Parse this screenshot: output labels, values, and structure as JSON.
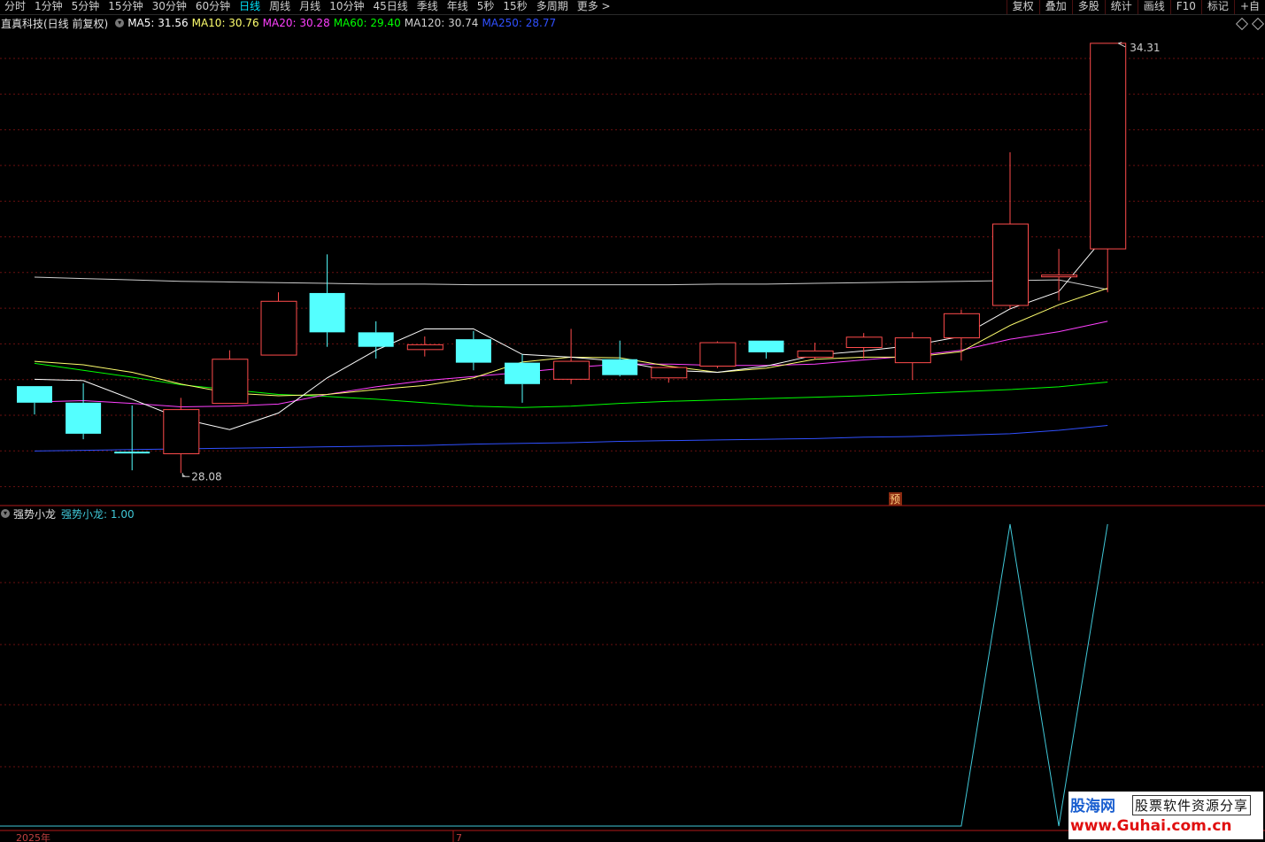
{
  "toolbar": {
    "periods": [
      "分时",
      "1分钟",
      "5分钟",
      "15分钟",
      "30分钟",
      "60分钟",
      "日线",
      "周线",
      "月线",
      "10分钟",
      "45日线",
      "季线",
      "年线",
      "5秒",
      "15秒",
      "多周期",
      "更多 >"
    ],
    "active_period": "日线",
    "right_buttons": [
      "复权",
      "叠加",
      "多股",
      "统计",
      "画线",
      "F10",
      "标记",
      "+自"
    ]
  },
  "main_info": {
    "title": "直真科技(日线 前复权)",
    "ma5": "MA5: 31.56",
    "ma10": "MA10: 30.76",
    "ma20": "MA20: 30.28",
    "ma60": "MA60: 29.40",
    "ma120": "MA120: 30.74",
    "ma250": "MA250: 28.77"
  },
  "colors": {
    "up": "#ff4c4c",
    "down": "#54ffff",
    "ma5": "#ffffff",
    "ma10": "#ffff6e",
    "ma20": "#ff40ff",
    "ma60": "#00ff00",
    "ma120": "#cccccc",
    "ma250": "#3050ff",
    "indicator": "#40c8d8",
    "grid": "#6a1010"
  },
  "price_labels": {
    "high": "34.31",
    "low": "28.08"
  },
  "pre_marker": "预",
  "sub_info": {
    "name": "强势小龙",
    "value_label": "强势小龙: 1.00"
  },
  "time_axis": {
    "labels": [
      "2025年",
      "7"
    ]
  },
  "watermark": {
    "site_name": "股海网",
    "slogan": "股票软件资源分享",
    "url": "www.Guhai.com.cn"
  },
  "chart_data": {
    "type": "candlestick",
    "candles": [
      {
        "open": 29.34,
        "close": 29.1,
        "high": 29.34,
        "low": 28.93
      },
      {
        "open": 29.1,
        "close": 28.65,
        "high": 29.38,
        "low": 28.57
      },
      {
        "open": 28.39,
        "close": 28.37,
        "high": 29.06,
        "low": 28.12
      },
      {
        "open": 28.36,
        "close": 29.0,
        "high": 29.17,
        "low": 28.08
      },
      {
        "open": 29.09,
        "close": 29.73,
        "high": 29.86,
        "low": 29.09
      },
      {
        "open": 29.79,
        "close": 30.57,
        "high": 30.7,
        "low": 29.79
      },
      {
        "open": 30.69,
        "close": 30.12,
        "high": 31.25,
        "low": 29.91
      },
      {
        "open": 30.12,
        "close": 29.91,
        "high": 30.28,
        "low": 29.74
      },
      {
        "open": 29.87,
        "close": 29.94,
        "high": 30.06,
        "low": 29.77
      },
      {
        "open": 30.02,
        "close": 29.68,
        "high": 30.14,
        "low": 29.57
      },
      {
        "open": 29.68,
        "close": 29.37,
        "high": 29.8,
        "low": 29.1
      },
      {
        "open": 29.44,
        "close": 29.7,
        "high": 30.17,
        "low": 29.37
      },
      {
        "open": 29.73,
        "close": 29.5,
        "high": 30.0,
        "low": 29.48
      },
      {
        "open": 29.46,
        "close": 29.61,
        "high": 29.61,
        "low": 29.39
      },
      {
        "open": 29.63,
        "close": 29.97,
        "high": 29.99,
        "low": 29.6
      },
      {
        "open": 30.0,
        "close": 29.83,
        "high": 30.0,
        "low": 29.74
      },
      {
        "open": 29.76,
        "close": 29.85,
        "high": 29.97,
        "low": 29.73
      },
      {
        "open": 29.9,
        "close": 30.05,
        "high": 30.11,
        "low": 29.74
      },
      {
        "open": 29.68,
        "close": 30.04,
        "high": 30.12,
        "low": 29.43
      },
      {
        "open": 30.04,
        "close": 30.39,
        "high": 30.45,
        "low": 29.71
      },
      {
        "open": 30.51,
        "close": 31.69,
        "high": 32.73,
        "low": 30.46
      },
      {
        "open": 30.95,
        "close": 30.95,
        "high": 31.33,
        "low": 30.58
      },
      {
        "open": 31.33,
        "close": 34.31,
        "high": 34.31,
        "low": 30.7
      }
    ],
    "ma5": [
      29.44,
      29.42,
      29.15,
      28.87,
      28.71,
      28.95,
      29.46,
      29.86,
      30.17,
      30.17,
      29.8,
      29.76,
      29.7,
      29.57,
      29.54,
      29.63,
      29.79,
      29.85,
      29.93,
      30.06,
      30.46,
      30.71,
      31.56
    ],
    "ma10": [
      29.7,
      29.65,
      29.54,
      29.37,
      29.24,
      29.2,
      29.22,
      29.29,
      29.35,
      29.46,
      29.69,
      29.76,
      29.75,
      29.63,
      29.54,
      29.6,
      29.73,
      29.76,
      29.76,
      29.84,
      30.22,
      30.52,
      30.76
    ],
    "ma20": [
      29.11,
      29.13,
      29.09,
      29.04,
      29.05,
      29.08,
      29.22,
      29.33,
      29.42,
      29.48,
      29.54,
      29.61,
      29.66,
      29.66,
      29.64,
      29.64,
      29.66,
      29.72,
      29.78,
      29.86,
      30.02,
      30.13,
      30.28
    ],
    "ma60": [
      29.67,
      29.57,
      29.47,
      29.36,
      29.29,
      29.22,
      29.19,
      29.15,
      29.1,
      29.05,
      29.03,
      29.05,
      29.09,
      29.12,
      29.14,
      29.16,
      29.18,
      29.2,
      29.23,
      29.26,
      29.29,
      29.33,
      29.4
    ],
    "ma120": [
      30.92,
      30.9,
      30.88,
      30.86,
      30.85,
      30.84,
      30.83,
      30.82,
      30.82,
      30.81,
      30.81,
      30.81,
      30.81,
      30.81,
      30.82,
      30.82,
      30.83,
      30.84,
      30.85,
      30.86,
      30.87,
      30.88,
      30.74
    ],
    "ma250": [
      28.4,
      28.41,
      28.42,
      28.43,
      28.44,
      28.45,
      28.46,
      28.47,
      28.48,
      28.5,
      28.51,
      28.52,
      28.54,
      28.55,
      28.56,
      28.57,
      28.58,
      28.6,
      28.61,
      28.63,
      28.65,
      28.7,
      28.77
    ],
    "indicator_values": [
      0,
      0,
      0,
      0,
      0,
      0,
      0,
      0,
      0,
      0,
      0,
      0,
      0,
      0,
      0,
      0,
      0,
      0,
      0,
      0,
      1,
      0,
      1
    ],
    "price_range": [
      27.75,
      34.45
    ],
    "indicator_range": [
      0,
      1
    ]
  }
}
